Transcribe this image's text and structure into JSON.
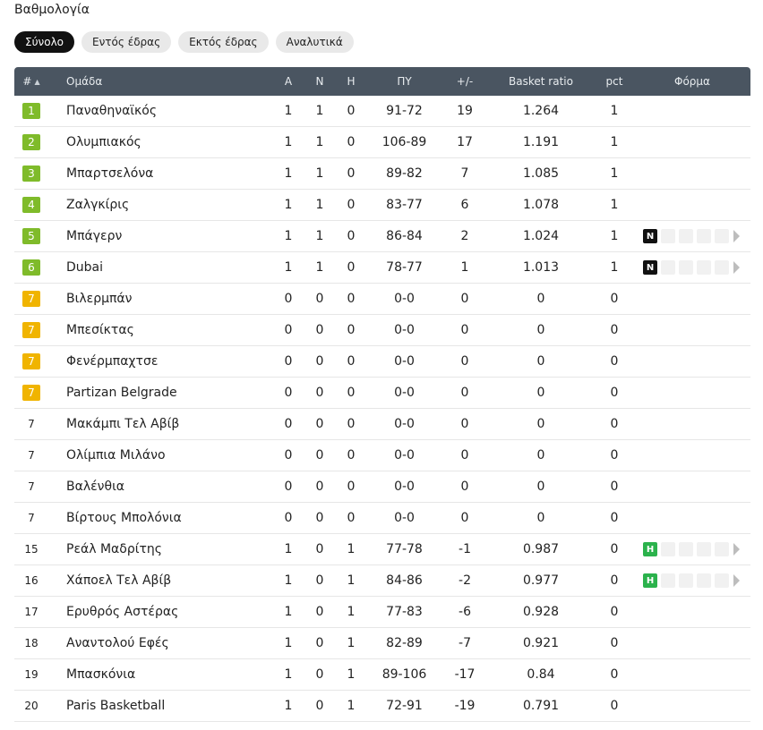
{
  "title": "Βαθμολογία",
  "tabs": [
    {
      "label": "Σύνολο",
      "active": true
    },
    {
      "label": "Εντός έδρας",
      "active": false
    },
    {
      "label": "Εκτός έδρας",
      "active": false
    },
    {
      "label": "Αναλυτικά",
      "active": false
    }
  ],
  "colors": {
    "header_bg": "#4a5561",
    "green_badge": "#7fbb2a",
    "yellow_badge": "#f0b400",
    "form_h": "#2bb24c",
    "form_n": "#111111"
  },
  "headers": {
    "pos": "#",
    "team": "Ομάδα",
    "a": "Α",
    "n": "Ν",
    "h": "Η",
    "py": "ΠΥ",
    "pm": "+/-",
    "br": "Basket ratio",
    "pct": "pct",
    "form": "Φόρμα"
  },
  "rows": [
    {
      "pos": "1",
      "badge": "green",
      "team": "Παναθηναϊκός",
      "a": "1",
      "n": "1",
      "h": "0",
      "py": "91-72",
      "pm": "19",
      "br": "1.264",
      "pct": "1",
      "form": ""
    },
    {
      "pos": "2",
      "badge": "green",
      "team": "Ολυμπιακός",
      "a": "1",
      "n": "1",
      "h": "0",
      "py": "106-89",
      "pm": "17",
      "br": "1.191",
      "pct": "1",
      "form": ""
    },
    {
      "pos": "3",
      "badge": "green",
      "team": "Μπαρτσελόνα",
      "a": "1",
      "n": "1",
      "h": "0",
      "py": "89-82",
      "pm": "7",
      "br": "1.085",
      "pct": "1",
      "form": ""
    },
    {
      "pos": "4",
      "badge": "green",
      "team": "Ζαλγκίρις",
      "a": "1",
      "n": "1",
      "h": "0",
      "py": "83-77",
      "pm": "6",
      "br": "1.078",
      "pct": "1",
      "form": ""
    },
    {
      "pos": "5",
      "badge": "green",
      "team": "Μπάγερν",
      "a": "1",
      "n": "1",
      "h": "0",
      "py": "86-84",
      "pm": "2",
      "br": "1.024",
      "pct": "1",
      "form": "N"
    },
    {
      "pos": "6",
      "badge": "green",
      "team": "Dubai",
      "a": "1",
      "n": "1",
      "h": "0",
      "py": "78-77",
      "pm": "1",
      "br": "1.013",
      "pct": "1",
      "form": "N"
    },
    {
      "pos": "7",
      "badge": "yellow",
      "team": "Βιλερμπάν",
      "a": "0",
      "n": "0",
      "h": "0",
      "py": "0-0",
      "pm": "0",
      "br": "0",
      "pct": "0",
      "form": ""
    },
    {
      "pos": "7",
      "badge": "yellow",
      "team": "Μπεσίκτας",
      "a": "0",
      "n": "0",
      "h": "0",
      "py": "0-0",
      "pm": "0",
      "br": "0",
      "pct": "0",
      "form": ""
    },
    {
      "pos": "7",
      "badge": "yellow",
      "team": "Φενέρμπαχτσε",
      "a": "0",
      "n": "0",
      "h": "0",
      "py": "0-0",
      "pm": "0",
      "br": "0",
      "pct": "0",
      "form": ""
    },
    {
      "pos": "7",
      "badge": "yellow",
      "team": "Partizan Belgrade",
      "a": "0",
      "n": "0",
      "h": "0",
      "py": "0-0",
      "pm": "0",
      "br": "0",
      "pct": "0",
      "form": ""
    },
    {
      "pos": "7",
      "badge": "",
      "team": "Μακάμπι Τελ Αβίβ",
      "a": "0",
      "n": "0",
      "h": "0",
      "py": "0-0",
      "pm": "0",
      "br": "0",
      "pct": "0",
      "form": ""
    },
    {
      "pos": "7",
      "badge": "",
      "team": "Ολίμπια Μιλάνο",
      "a": "0",
      "n": "0",
      "h": "0",
      "py": "0-0",
      "pm": "0",
      "br": "0",
      "pct": "0",
      "form": ""
    },
    {
      "pos": "7",
      "badge": "",
      "team": "Βαλένθια",
      "a": "0",
      "n": "0",
      "h": "0",
      "py": "0-0",
      "pm": "0",
      "br": "0",
      "pct": "0",
      "form": ""
    },
    {
      "pos": "7",
      "badge": "",
      "team": "Βίρτους Μπολόνια",
      "a": "0",
      "n": "0",
      "h": "0",
      "py": "0-0",
      "pm": "0",
      "br": "0",
      "pct": "0",
      "form": ""
    },
    {
      "pos": "15",
      "badge": "",
      "team": "Ρεάλ Μαδρίτης",
      "a": "1",
      "n": "0",
      "h": "1",
      "py": "77-78",
      "pm": "-1",
      "br": "0.987",
      "pct": "0",
      "form": "H"
    },
    {
      "pos": "16",
      "badge": "",
      "team": "Χάποελ Τελ Αβίβ",
      "a": "1",
      "n": "0",
      "h": "1",
      "py": "84-86",
      "pm": "-2",
      "br": "0.977",
      "pct": "0",
      "form": "H"
    },
    {
      "pos": "17",
      "badge": "",
      "team": "Ερυθρός Αστέρας",
      "a": "1",
      "n": "0",
      "h": "1",
      "py": "77-83",
      "pm": "-6",
      "br": "0.928",
      "pct": "0",
      "form": ""
    },
    {
      "pos": "18",
      "badge": "",
      "team": "Αναντολού Εφές",
      "a": "1",
      "n": "0",
      "h": "1",
      "py": "82-89",
      "pm": "-7",
      "br": "0.921",
      "pct": "0",
      "form": ""
    },
    {
      "pos": "19",
      "badge": "",
      "team": "Μπασκόνια",
      "a": "1",
      "n": "0",
      "h": "1",
      "py": "89-106",
      "pm": "-17",
      "br": "0.84",
      "pct": "0",
      "form": ""
    },
    {
      "pos": "20",
      "badge": "",
      "team": "Paris Basketball",
      "a": "1",
      "n": "0",
      "h": "1",
      "py": "72-91",
      "pm": "-19",
      "br": "0.791",
      "pct": "0",
      "form": ""
    }
  ]
}
